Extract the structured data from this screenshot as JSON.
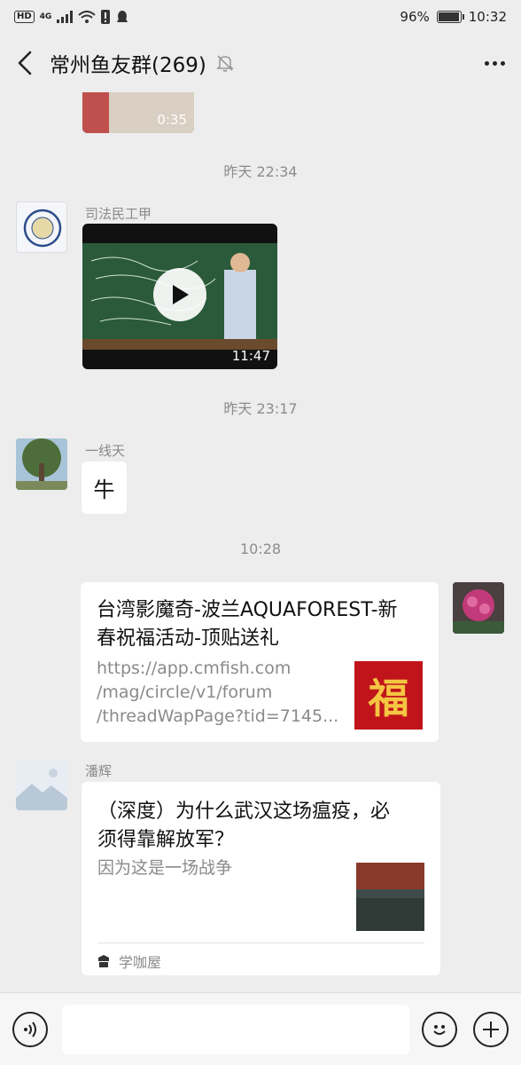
{
  "status_bar": {
    "left_badges": [
      "HD",
      "4G"
    ],
    "battery_percent_text": "96%",
    "battery_level": 0.96,
    "time": "10:32"
  },
  "header": {
    "title": "常州鱼友群(269)"
  },
  "messages": {
    "video_top": {
      "duration": "0:35"
    },
    "time1": "昨天 22:34",
    "msg1": {
      "sender": "司法民工甲",
      "duration": "11:47"
    },
    "time2": "昨天 23:17",
    "msg2": {
      "sender": "一线天",
      "text": "牛"
    },
    "time3": "10:28",
    "msg3": {
      "title_line1": "台湾影魔奇-波兰AQUAFOREST-新",
      "title_line2": "春祝福活动-顶贴送礼",
      "url_line1": "https://app.cmfish.com",
      "url_line2": "/mag/circle/v1/forum",
      "url_line3": "/threadWapPage?tid=7145...",
      "thumb_char": "福"
    },
    "msg4": {
      "sender": "潘辉",
      "title_line1": "（深度）为什么武汉这场瘟疫，必",
      "title_line2": "须得靠解放军？",
      "desc": "因为这是一场战争",
      "source": "学咖屋"
    }
  },
  "colors": {
    "background": "#ededed",
    "bubble": "#ffffff",
    "timestamp": "#8c8c8c"
  }
}
